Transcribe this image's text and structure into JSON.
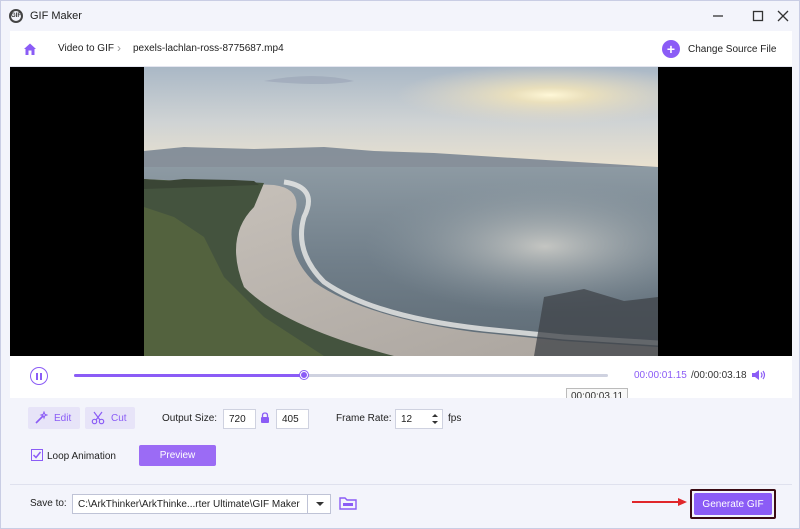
{
  "window": {
    "title": "GIF Maker",
    "app_icon_text": "GIF"
  },
  "breadcrumb": {
    "section": "Video to GIF",
    "file": "pexels-lachlan-ross-8775687.mp4"
  },
  "change_source": {
    "label": "Change Source File"
  },
  "player": {
    "current_time": "00:00:01.15",
    "total_time": "/00:00:03.18",
    "hover_time": "00:00:03.11",
    "progress": 0.43
  },
  "tools": {
    "edit_label": "Edit",
    "cut_label": "Cut"
  },
  "output": {
    "size_label": "Output Size:",
    "width": "720",
    "height": "405",
    "frame_rate_label": "Frame Rate:",
    "frame_rate": "12",
    "fps_unit": "fps"
  },
  "loop": {
    "label": "Loop Animation",
    "checked": true
  },
  "preview_label": "Preview",
  "save": {
    "label": "Save to:",
    "path": "C:\\ArkThinker\\ArkThinke...rter Ultimate\\GIF Maker"
  },
  "generate_label": "Generate GIF",
  "colors": {
    "accent": "#8b5cf6",
    "highlight_border": "#3a0b14",
    "arrow": "#e0262a"
  }
}
